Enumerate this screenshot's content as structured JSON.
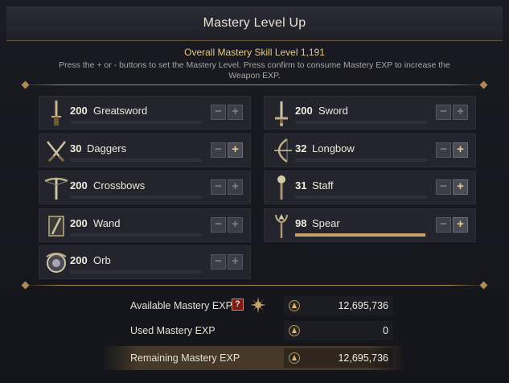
{
  "dialog": {
    "title": "Mastery Level Up"
  },
  "header": {
    "overall": "Overall Mastery Skill Level 1,191",
    "instructions": "Press the + or - buttons to set the Mastery Level. Press confirm to consume Mastery EXP to increase the Weapon EXP."
  },
  "weapons": [
    {
      "level": "200",
      "name": "Greatsword",
      "icon": "greatsword-icon",
      "progress": 0,
      "plus_enabled": false
    },
    {
      "level": "200",
      "name": "Sword",
      "icon": "sword-icon",
      "progress": 0,
      "plus_enabled": false
    },
    {
      "level": "30",
      "name": "Daggers",
      "icon": "daggers-icon",
      "progress": 0,
      "plus_enabled": true
    },
    {
      "level": "32",
      "name": "Longbow",
      "icon": "longbow-icon",
      "progress": 0,
      "plus_enabled": true
    },
    {
      "level": "200",
      "name": "Crossbows",
      "icon": "crossbow-icon",
      "progress": 0,
      "plus_enabled": false
    },
    {
      "level": "31",
      "name": "Staff",
      "icon": "staff-icon",
      "progress": 0,
      "plus_enabled": true
    },
    {
      "level": "200",
      "name": "Wand",
      "icon": "wand-icon",
      "progress": 0,
      "plus_enabled": false
    },
    {
      "level": "98",
      "name": "Spear",
      "icon": "spear-icon",
      "progress": 0.99,
      "plus_enabled": true
    },
    {
      "level": "200",
      "name": "Orb",
      "icon": "orb-icon",
      "progress": 0,
      "plus_enabled": false
    }
  ],
  "buttons": {
    "minus": "−",
    "plus": "+"
  },
  "exp": {
    "available_label": "Available Mastery EXP",
    "available_value": "12,695,736",
    "help_glyph": "?",
    "used_label": "Used Mastery EXP",
    "used_value": "0",
    "remaining_label": "Remaining Mastery EXP",
    "remaining_value": "12,695,736"
  },
  "colors": {
    "accent": "#c9a46a",
    "title_gold": "#e8c882"
  }
}
